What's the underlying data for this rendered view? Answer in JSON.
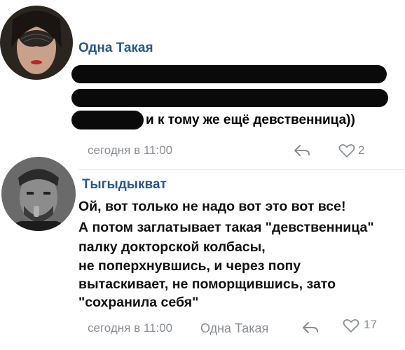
{
  "comments": [
    {
      "author": "Одна Такая",
      "visible_text": "и к тому же ещё девственница))",
      "time": "сегодня в 11:00",
      "likes": "2"
    },
    {
      "author": "Тыгыдыкват",
      "lines": [
        "Ой, вот только не надо вот это вот все!",
        "А потом заглатывает такая \"девственница\"",
        "палку докторской колбасы,",
        "не поперхнувшись, и через попу",
        "вытаскивает, не поморщившись, зато",
        "\"сохранила себя\""
      ],
      "time": "сегодня в 11:00",
      "reply_to": "Одна Такая",
      "likes": "17"
    }
  ],
  "icons": {
    "reply": "reply-icon",
    "like": "heart-icon"
  },
  "colors": {
    "author": "#2a5885",
    "meta": "#8a8e94",
    "redaction": "#0a0a0a"
  }
}
